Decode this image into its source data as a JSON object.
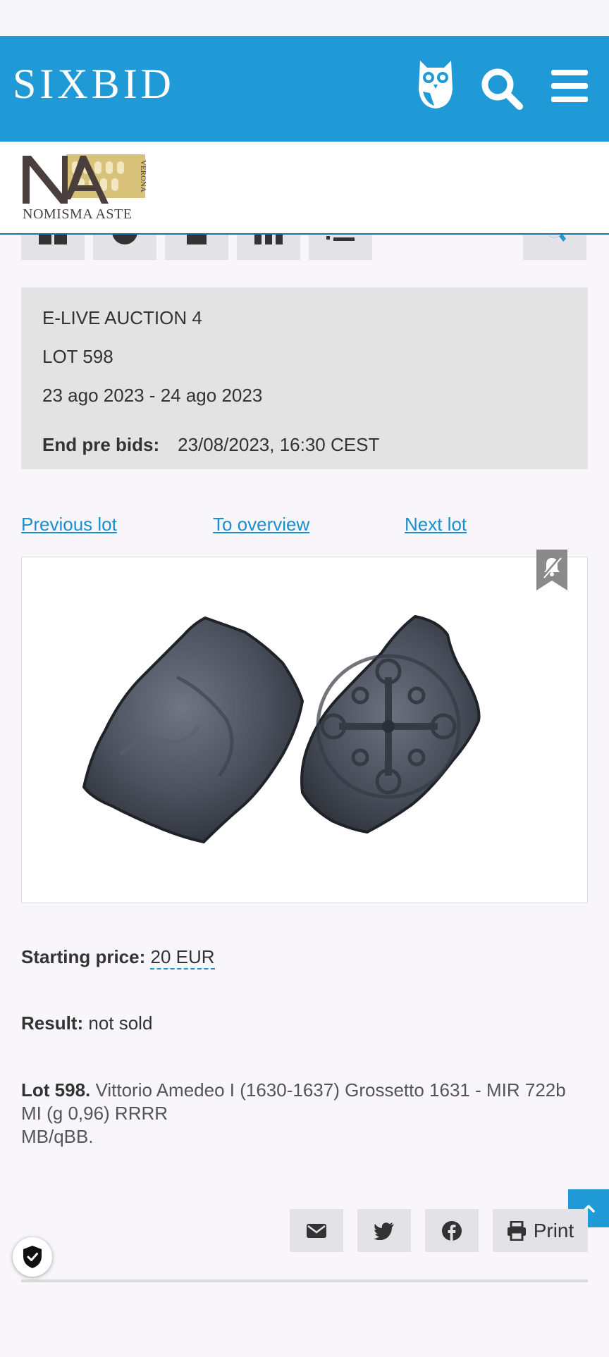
{
  "header": {
    "brand": "SIXBID",
    "colors": {
      "brand_blue": "#1f9ad6",
      "link": "#1a8fd0"
    }
  },
  "auctioneer": {
    "logo_name": "NOMISMA ASTE",
    "logo_sub": "VERONA",
    "logo_letters": "NA"
  },
  "toolbar": {
    "icons": [
      "grid-icon",
      "clock-icon",
      "document-icon",
      "columns-icon",
      "list-icon",
      "search-icon"
    ]
  },
  "auction": {
    "title": "E-LIVE AUCTION 4",
    "lot_label": "LOT 598",
    "dates": "23 ago 2023 - 24 ago 2023",
    "end_prebids_label": "End pre bids:",
    "end_prebids_value": "23/08/2023, 16:30 CEST"
  },
  "nav": {
    "previous": "Previous lot",
    "overview": "To overview",
    "next": "Next lot"
  },
  "lot": {
    "starting_price_label": "Starting price:",
    "starting_price_value": "20 EUR",
    "result_label": "Result:",
    "result_value": "not sold",
    "number_label": "Lot 598.",
    "description_line1": " Vittorio Amedeo I (1630-1637) Grossetto 1631 - MIR 722b MI (g 0,96) RRRR",
    "description_line2": "MB/qBB."
  },
  "share": {
    "print_label": "Print",
    "icons": [
      "envelope-icon",
      "twitter-icon",
      "facebook-icon",
      "printer-icon"
    ]
  }
}
